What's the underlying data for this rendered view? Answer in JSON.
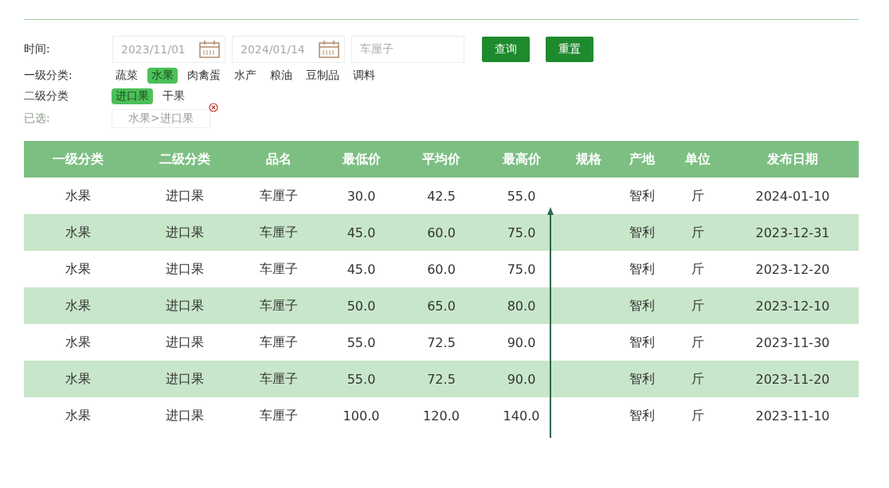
{
  "filters": {
    "time_label": "时间:",
    "start_date": "2023/11/01",
    "end_date": "2024/01/14",
    "keyword": "车厘子",
    "query_button": "查询",
    "reset_button": "重置",
    "level1_label": "一级分类:",
    "level1": [
      {
        "label": "蔬菜",
        "selected": false
      },
      {
        "label": "水果",
        "selected": true
      },
      {
        "label": "肉禽蛋",
        "selected": false
      },
      {
        "label": "水产",
        "selected": false
      },
      {
        "label": "粮油",
        "selected": false
      },
      {
        "label": "豆制品",
        "selected": false
      },
      {
        "label": "调料",
        "selected": false
      }
    ],
    "level2_label": "二级分类",
    "level2": [
      {
        "label": "进口果",
        "selected": true
      },
      {
        "label": "干果",
        "selected": false
      }
    ],
    "chosen_label": "已选:",
    "chosen": "水果>进口果"
  },
  "table": {
    "columns": [
      "一级分类",
      "二级分类",
      "品名",
      "最低价",
      "平均价",
      "最高价",
      "规格",
      "产地",
      "单位",
      "发布日期"
    ],
    "rows": [
      [
        "水果",
        "进口果",
        "车厘子",
        "30.0",
        "42.5",
        "55.0",
        "",
        "智利",
        "斤",
        "2024-01-10"
      ],
      [
        "水果",
        "进口果",
        "车厘子",
        "45.0",
        "60.0",
        "75.0",
        "",
        "智利",
        "斤",
        "2023-12-31"
      ],
      [
        "水果",
        "进口果",
        "车厘子",
        "45.0",
        "60.0",
        "75.0",
        "",
        "智利",
        "斤",
        "2023-12-20"
      ],
      [
        "水果",
        "进口果",
        "车厘子",
        "50.0",
        "65.0",
        "80.0",
        "",
        "智利",
        "斤",
        "2023-12-10"
      ],
      [
        "水果",
        "进口果",
        "车厘子",
        "55.0",
        "72.5",
        "90.0",
        "",
        "智利",
        "斤",
        "2023-11-30"
      ],
      [
        "水果",
        "进口果",
        "车厘子",
        "55.0",
        "72.5",
        "90.0",
        "",
        "智利",
        "斤",
        "2023-11-20"
      ],
      [
        "水果",
        "进口果",
        "车厘子",
        "100.0",
        "120.0",
        "140.0",
        "",
        "智利",
        "斤",
        "2023-11-10"
      ]
    ]
  }
}
